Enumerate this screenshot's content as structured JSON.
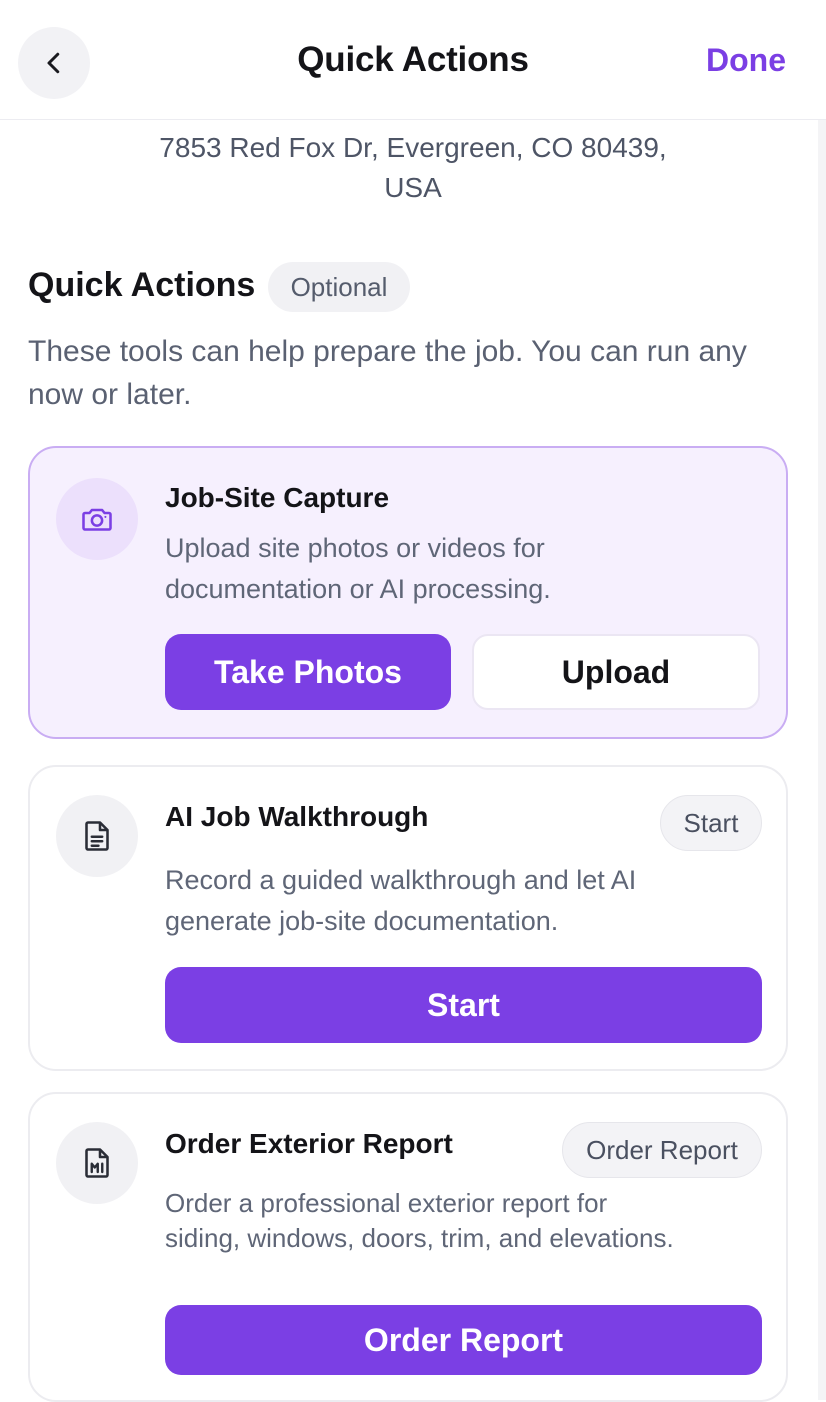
{
  "header": {
    "title": "Quick Actions",
    "done_label": "Done"
  },
  "address": {
    "line1": "7853 Red Fox Dr, Evergreen, CO 80439,",
    "line2": "USA"
  },
  "section": {
    "title": "Quick Actions",
    "badge": "Optional",
    "description": "These tools can help prepare the job. You can run any now or later."
  },
  "cards": [
    {
      "icon": "camera-icon",
      "title": "Job-Site Capture",
      "description": "Upload site photos or videos for documentation or AI processing.",
      "primary_label": "Take Photos",
      "secondary_label": "Upload"
    },
    {
      "icon": "document-icon",
      "title": "AI Job Walkthrough",
      "pill_label": "Start",
      "description": "Record a guided walkthrough and let AI generate job-site documentation.",
      "primary_label": "Start"
    },
    {
      "icon": "report-icon",
      "title": "Order Exterior Report",
      "pill_label": "Order Report",
      "description": "Order a professional exterior report for siding, windows, doors, trim, and elevations.",
      "primary_label": "Order Report"
    }
  ],
  "colors": {
    "accent": "#7b3fe4",
    "highlight_card_bg": "#f6f0fe",
    "highlight_card_border": "#c9adf3"
  }
}
